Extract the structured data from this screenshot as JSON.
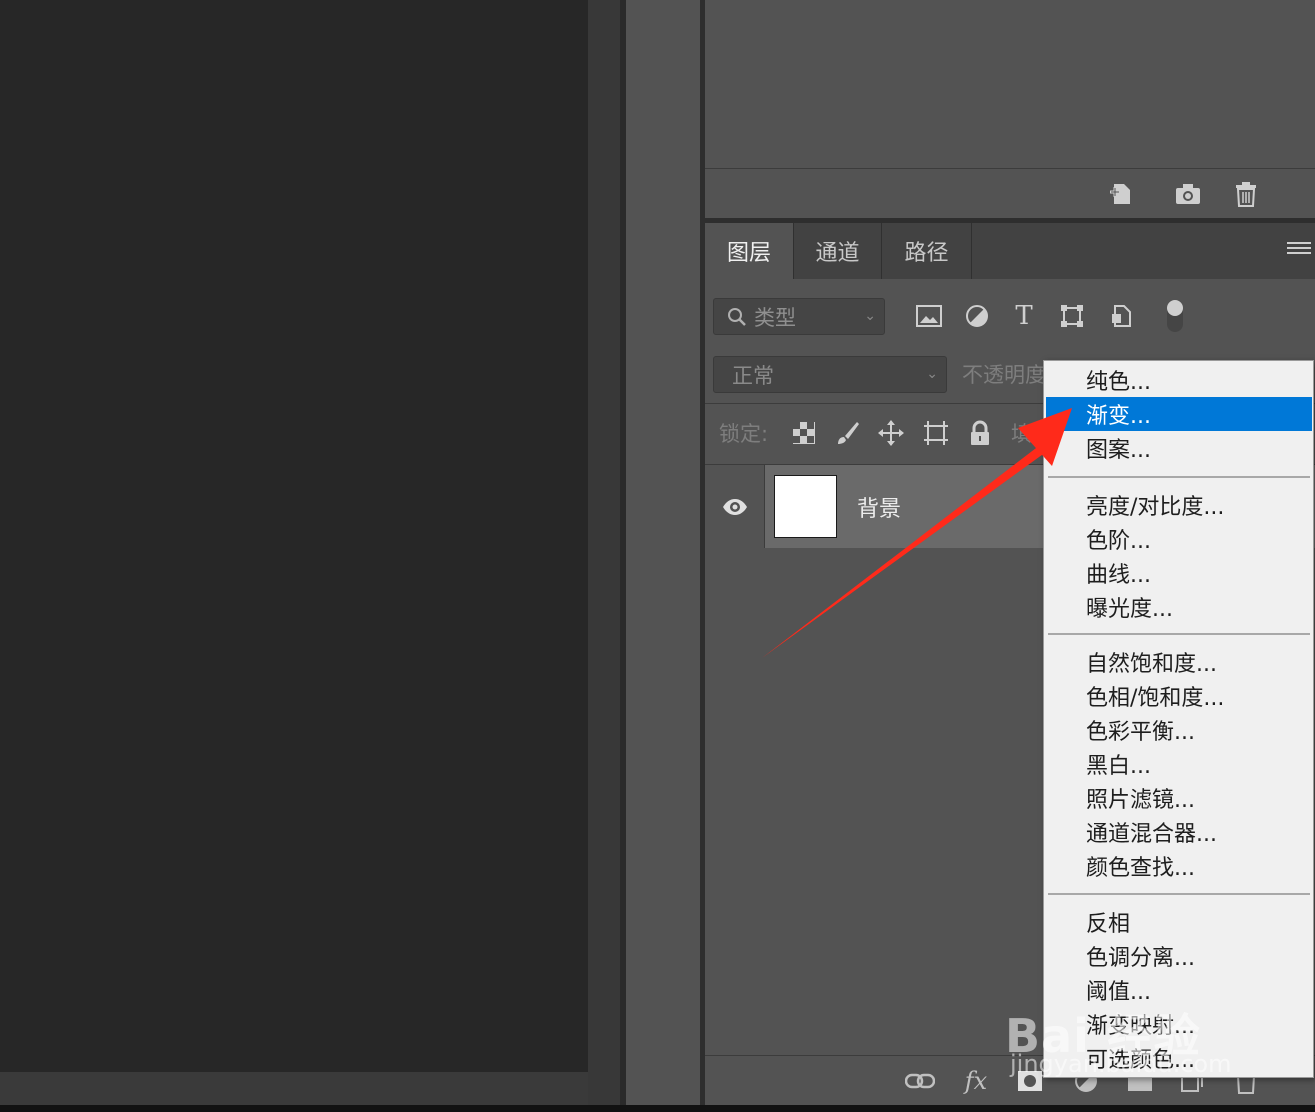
{
  "history_panel": {
    "icons": [
      "new-snapshot-icon",
      "camera-icon",
      "trash-icon"
    ]
  },
  "layers_panel": {
    "tabs": [
      {
        "label": "图层",
        "active": true
      },
      {
        "label": "通道",
        "active": false
      },
      {
        "label": "路径",
        "active": false
      }
    ],
    "filter": {
      "placeholder": "类型",
      "icons": [
        "image-filter-icon",
        "adjustment-filter-icon",
        "type-filter-icon",
        "shape-filter-icon",
        "smart-object-filter-icon",
        "filter-toggle-icon"
      ]
    },
    "blend_mode": "正常",
    "opacity_label": "不透明度",
    "lock_label": "锁定:",
    "fill_label": "填充",
    "layers": [
      {
        "name": "背景",
        "visible": true
      }
    ],
    "footer_icons": [
      "link-icon",
      "fx-icon",
      "mask-icon",
      "adjustment-icon",
      "group-icon",
      "new-layer-icon",
      "delete-icon"
    ]
  },
  "context_menu": {
    "highlight_color": "#0078d7",
    "groups": [
      [
        {
          "label": "纯色...",
          "highlighted": false
        },
        {
          "label": "渐变...",
          "highlighted": true
        },
        {
          "label": "图案...",
          "highlighted": false
        }
      ],
      [
        {
          "label": "亮度/对比度...",
          "highlighted": false
        },
        {
          "label": "色阶...",
          "highlighted": false
        },
        {
          "label": "曲线...",
          "highlighted": false
        },
        {
          "label": "曝光度...",
          "highlighted": false
        }
      ],
      [
        {
          "label": "自然饱和度...",
          "highlighted": false
        },
        {
          "label": "色相/饱和度...",
          "highlighted": false
        },
        {
          "label": "色彩平衡...",
          "highlighted": false
        },
        {
          "label": "黑白...",
          "highlighted": false
        },
        {
          "label": "照片滤镜...",
          "highlighted": false
        },
        {
          "label": "通道混合器...",
          "highlighted": false
        },
        {
          "label": "颜色查找...",
          "highlighted": false
        }
      ],
      [
        {
          "label": "反相",
          "highlighted": false
        },
        {
          "label": "色调分离...",
          "highlighted": false
        },
        {
          "label": "阈值...",
          "highlighted": false
        },
        {
          "label": "渐变映射...",
          "highlighted": false
        },
        {
          "label": "可选颜色...",
          "highlighted": false
        }
      ]
    ]
  },
  "annotation": {
    "arrow_color": "#ff2a1a"
  },
  "watermark": {
    "text": "Bai 经验",
    "sub": "jingyan.baidu.com"
  }
}
